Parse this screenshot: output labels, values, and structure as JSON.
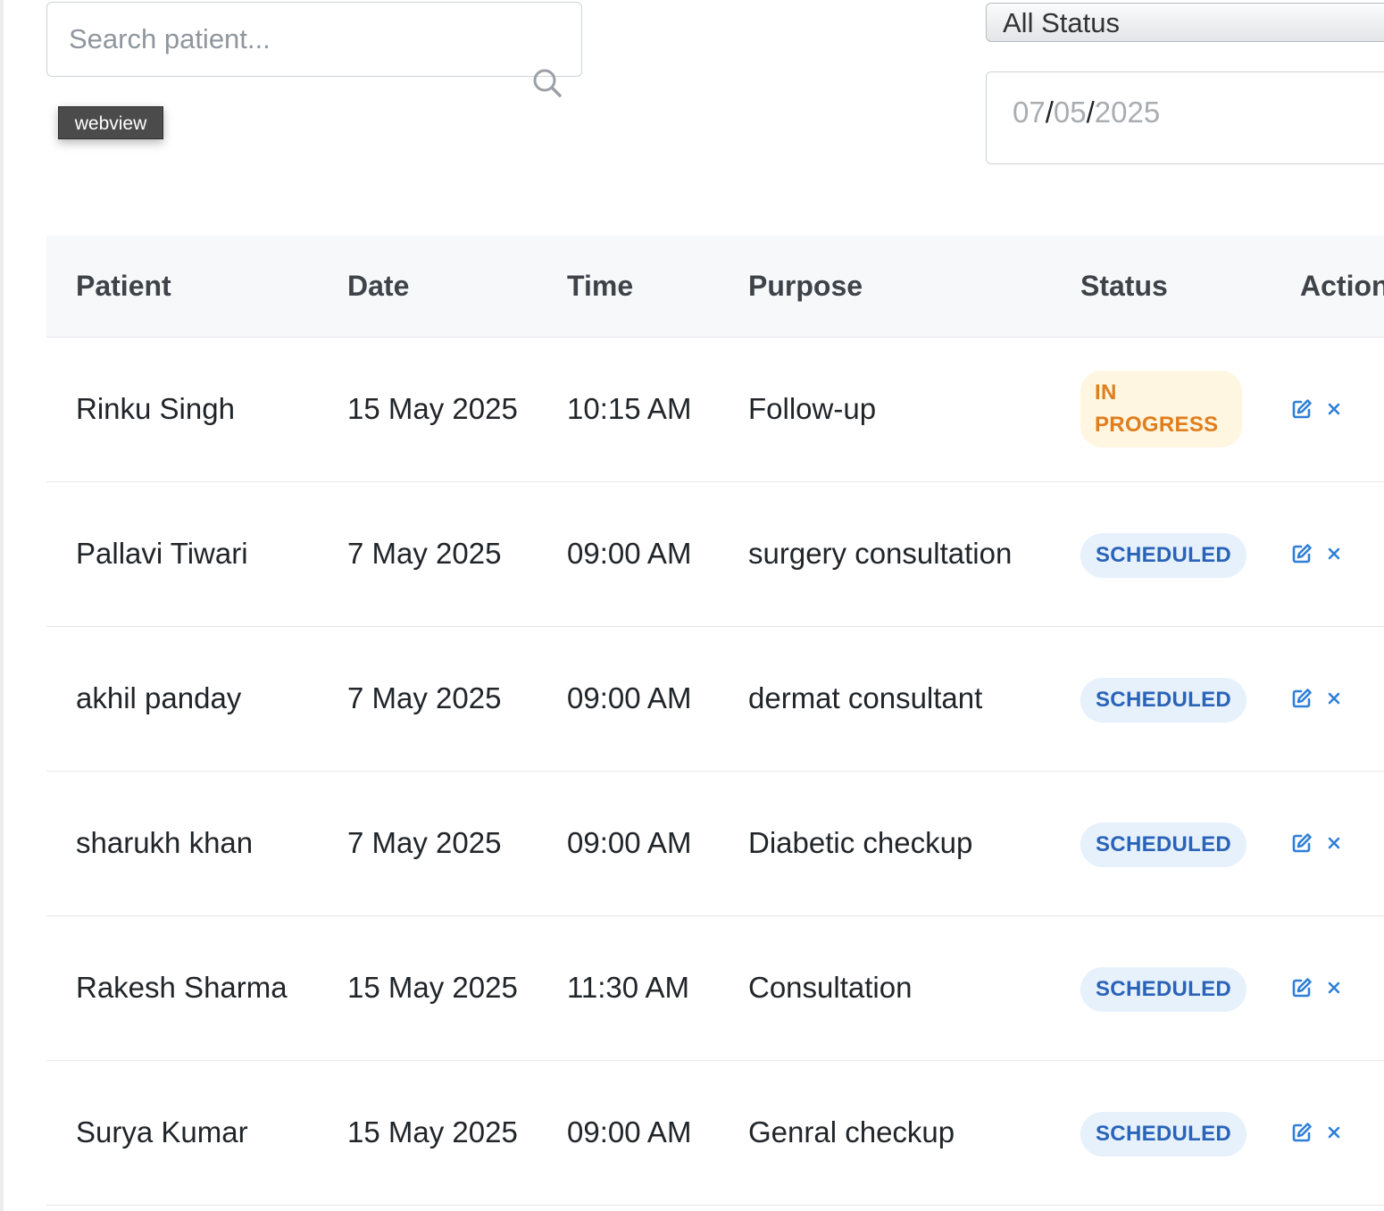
{
  "search": {
    "placeholder": "Search patient...",
    "value": ""
  },
  "tooltip": {
    "text": "webview"
  },
  "filters": {
    "status_selected": "All Status",
    "date": {
      "month": "07",
      "day": "05",
      "year": "2025",
      "separator": "/"
    }
  },
  "table": {
    "headers": {
      "patient": "Patient",
      "date": "Date",
      "time": "Time",
      "purpose": "Purpose",
      "status": "Status",
      "action": "Action"
    },
    "rows": [
      {
        "patient": "Rinku Singh",
        "date": "15 May 2025",
        "time": "10:15 AM",
        "purpose": "Follow-up",
        "status": "IN PROGRESS",
        "status_type": "in-progress"
      },
      {
        "patient": "Pallavi Tiwari",
        "date": "7 May 2025",
        "time": "09:00 AM",
        "purpose": "surgery consultation",
        "status": "SCHEDULED",
        "status_type": "scheduled"
      },
      {
        "patient": "akhil panday",
        "date": "7 May 2025",
        "time": "09:00 AM",
        "purpose": "dermat consultant",
        "status": "SCHEDULED",
        "status_type": "scheduled"
      },
      {
        "patient": "sharukh khan",
        "date": "7 May 2025",
        "time": "09:00 AM",
        "purpose": "Diabetic checkup",
        "status": "SCHEDULED",
        "status_type": "scheduled"
      },
      {
        "patient": "Rakesh Sharma",
        "date": "15 May 2025",
        "time": "11:30 AM",
        "purpose": "Consultation",
        "status": "SCHEDULED",
        "status_type": "scheduled"
      },
      {
        "patient": "Surya Kumar",
        "date": "15 May 2025",
        "time": "09:00 AM",
        "purpose": "Genral checkup",
        "status": "SCHEDULED",
        "status_type": "scheduled"
      }
    ]
  },
  "icons": {
    "search": "search-icon",
    "edit": "edit-icon",
    "delete": "close-icon"
  },
  "colors": {
    "scheduled_bg": "#e6f1fc",
    "scheduled_text": "#2a63b8",
    "in_progress_bg": "#fef6e1",
    "in_progress_text": "#e07d1c",
    "edit_icon": "#2f7fd8",
    "delete_icon": "#2f7fd8"
  }
}
